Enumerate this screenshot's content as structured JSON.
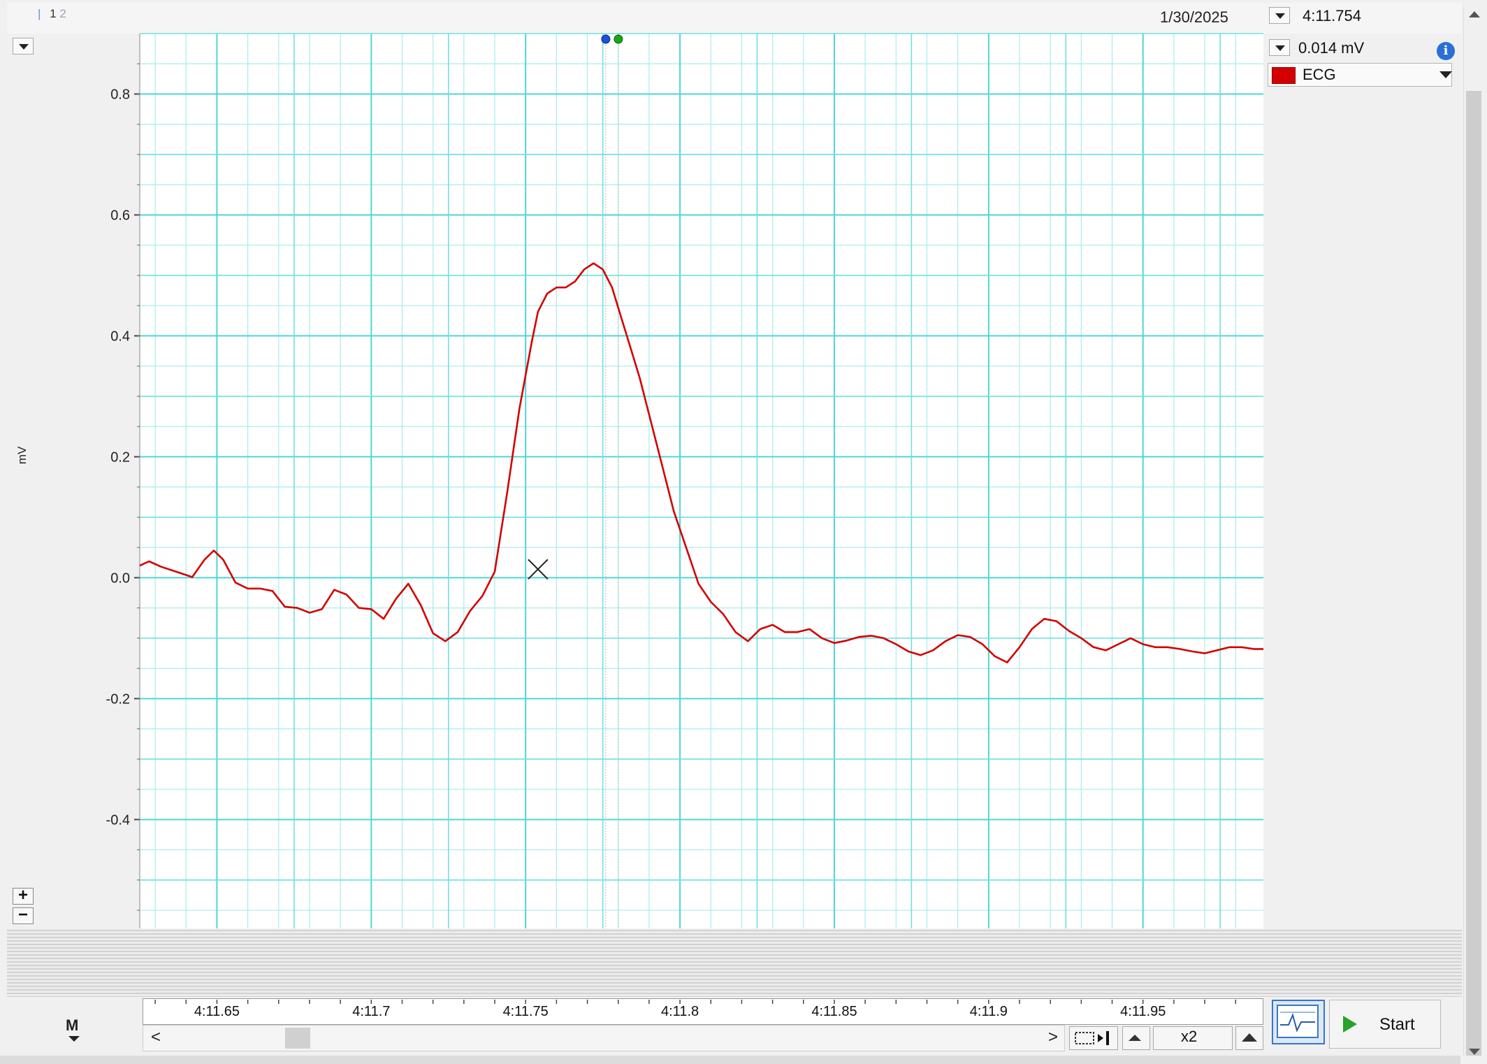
{
  "header": {
    "tabs": [
      "1",
      "2"
    ],
    "date": "1/30/2025",
    "cursor_time": "4:11.754",
    "cursor_value": "0.014 mV"
  },
  "channel": {
    "name": "ECG",
    "color": "#d40000",
    "unit": "mV"
  },
  "controls": {
    "zoom_label": "x2",
    "start_label": "Start",
    "scroll_left": "<",
    "scroll_right": ">",
    "marker_icon": "M",
    "plus_label": "+",
    "minus_label": "−"
  },
  "icons": {
    "info": "info-icon",
    "scope_view": "scope-view-icon",
    "play": "play-icon",
    "marker": "marker-icon"
  },
  "chart_data": {
    "type": "line",
    "ylabel": "mV",
    "ylim": [
      -0.58,
      0.9
    ],
    "xlim": [
      4.625,
      4.989
    ],
    "y_ticks": [
      "0.8",
      "0.6",
      "0.4",
      "0.2",
      "0.0",
      "-0.2",
      "-0.4"
    ],
    "x_ticks": [
      "4:11.65",
      "4:11.7",
      "4:11.75",
      "4:11.8",
      "4:11.85",
      "4:11.9",
      "4:11.95"
    ],
    "grid": true,
    "cursor_x": 4.778,
    "cursor_point": {
      "x": 4.754,
      "y": 0.014
    },
    "series": [
      {
        "color": "#d40000",
        "x": [
          4.625,
          4.628,
          4.632,
          4.638,
          4.642,
          4.646,
          4.649,
          4.652,
          4.656,
          4.66,
          4.664,
          4.668,
          4.672,
          4.676,
          4.68,
          4.684,
          4.688,
          4.692,
          4.696,
          4.7,
          4.704,
          4.708,
          4.712,
          4.716,
          4.72,
          4.724,
          4.728,
          4.732,
          4.736,
          4.74,
          4.744,
          4.748,
          4.752,
          4.754,
          4.757,
          4.76,
          4.763,
          4.766,
          4.769,
          4.772,
          4.775,
          4.778,
          4.781,
          4.784,
          4.787,
          4.79,
          4.794,
          4.798,
          4.802,
          4.806,
          4.81,
          4.814,
          4.818,
          4.822,
          4.826,
          4.83,
          4.834,
          4.838,
          4.842,
          4.846,
          4.85,
          4.854,
          4.858,
          4.862,
          4.866,
          4.87,
          4.874,
          4.878,
          4.882,
          4.886,
          4.89,
          4.894,
          4.898,
          4.902,
          4.906,
          4.91,
          4.914,
          4.918,
          4.922,
          4.926,
          4.93,
          4.934,
          4.938,
          4.942,
          4.946,
          4.95,
          4.954,
          4.958,
          4.962,
          4.966,
          4.97,
          4.974,
          4.978,
          4.982,
          4.986,
          4.989
        ],
        "y": [
          0.02,
          0.027,
          0.018,
          0.008,
          0.001,
          0.03,
          0.045,
          0.03,
          -0.008,
          -0.018,
          -0.018,
          -0.022,
          -0.048,
          -0.05,
          -0.058,
          -0.052,
          -0.02,
          -0.028,
          -0.05,
          -0.052,
          -0.068,
          -0.035,
          -0.01,
          -0.045,
          -0.092,
          -0.105,
          -0.09,
          -0.055,
          -0.03,
          0.01,
          0.14,
          0.28,
          0.39,
          0.44,
          0.47,
          0.48,
          0.48,
          0.49,
          0.51,
          0.52,
          0.51,
          0.48,
          0.43,
          0.38,
          0.33,
          0.27,
          0.19,
          0.11,
          0.05,
          -0.01,
          -0.04,
          -0.06,
          -0.09,
          -0.105,
          -0.085,
          -0.078,
          -0.09,
          -0.09,
          -0.085,
          -0.1,
          -0.108,
          -0.104,
          -0.098,
          -0.096,
          -0.1,
          -0.11,
          -0.122,
          -0.128,
          -0.12,
          -0.105,
          -0.095,
          -0.098,
          -0.11,
          -0.13,
          -0.14,
          -0.115,
          -0.085,
          -0.068,
          -0.072,
          -0.088,
          -0.1,
          -0.115,
          -0.12,
          -0.11,
          -0.1,
          -0.11,
          -0.115,
          -0.115,
          -0.118,
          -0.122,
          -0.125,
          -0.12,
          -0.115,
          -0.115,
          -0.118,
          -0.118
        ]
      }
    ]
  }
}
